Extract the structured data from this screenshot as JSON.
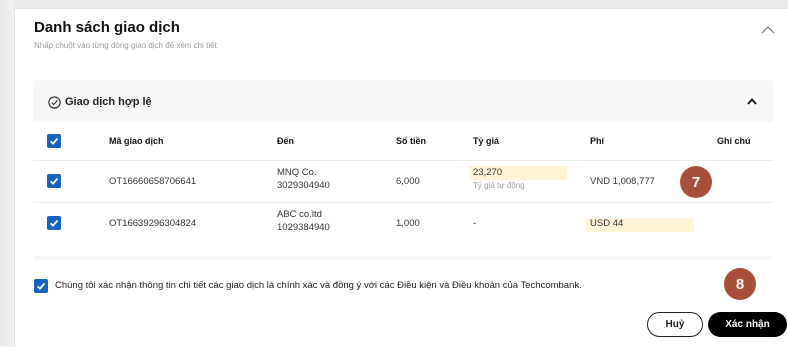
{
  "panel": {
    "title": "Danh sách giao dịch",
    "subtitle": "Nhấp chuột vào từng dòng giao dịch để xem chi tiết"
  },
  "group": {
    "title": "Giao dịch hợp lệ"
  },
  "table": {
    "headers": {
      "code": "Mã giao dịch",
      "to": "Đến",
      "amount": "Số tiền",
      "rate": "Tỷ giá",
      "fee": "Phí",
      "note": "Ghi chú"
    },
    "rows": [
      {
        "checked": true,
        "code": "OT16660658706641",
        "to_name": "MNQ Co.",
        "to_account": "3029304940",
        "amount": "6,000",
        "rate": "23,270",
        "rate_sub": "Tỷ giá tự động",
        "fee": "VND 1,008,777"
      },
      {
        "checked": true,
        "code": "OT16639296304824",
        "to_name": "ABC co.ltd",
        "to_account": "1029384940",
        "amount": "1,000",
        "rate": "-",
        "fee": "USD 44"
      }
    ]
  },
  "confirm": {
    "checked": true,
    "text": "Chúng tôi xác nhận thông tin chi tiết các giao dịch là chính xác và đồng ý với các Điều kiện và Điều khoản của Techcombank."
  },
  "buttons": {
    "cancel": "Huỷ",
    "submit": "Xác nhận"
  },
  "badges": {
    "step7": "7",
    "step8": "8"
  },
  "colors": {
    "checkbox": "#1565c0",
    "highlight": "#fff5d6",
    "badge": "#a9503a",
    "primary_button": "#000000"
  }
}
